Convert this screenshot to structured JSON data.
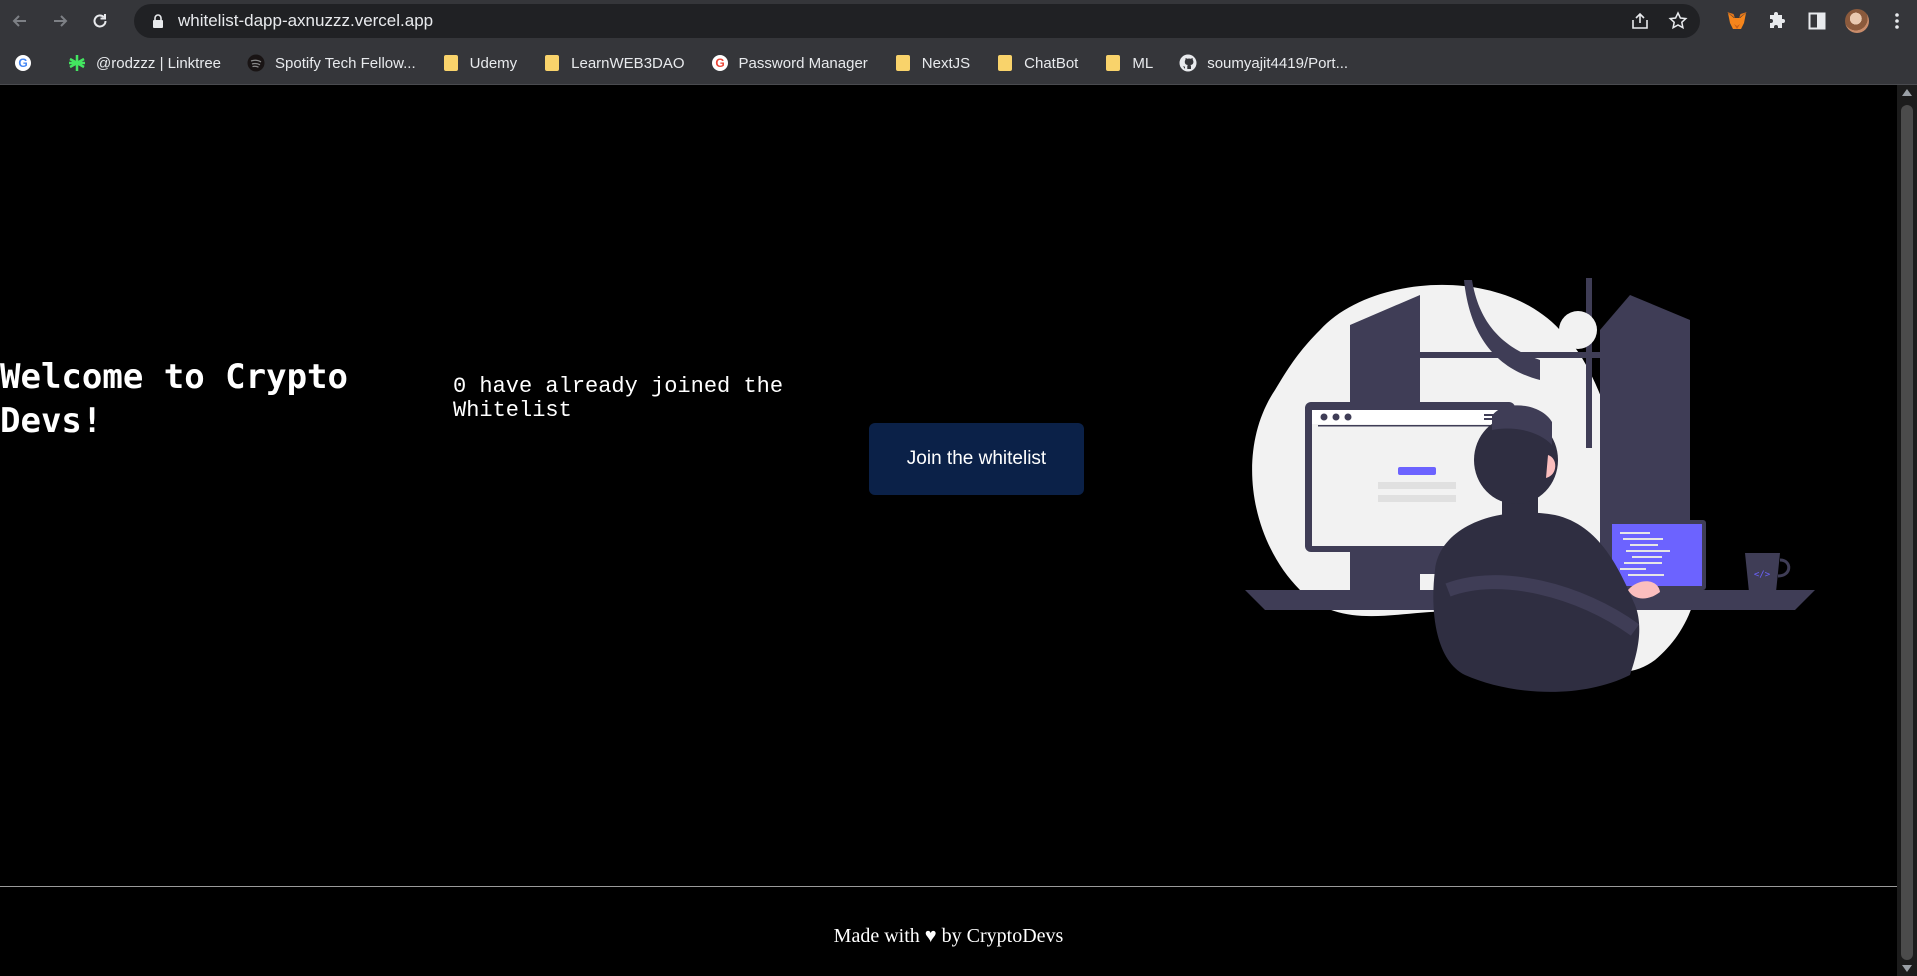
{
  "browser": {
    "url": "whitelist-dapp-axnuzzz.vercel.app",
    "bookmarks": [
      {
        "label": "",
        "icon": "google-icon"
      },
      {
        "label": "@rodzzz | Linktree",
        "icon": "linktree-icon"
      },
      {
        "label": "Spotify Tech Fellow...",
        "icon": "spotify-icon"
      },
      {
        "label": "Udemy",
        "icon": "folder-icon"
      },
      {
        "label": "LearnWEB3DAO",
        "icon": "folder-icon"
      },
      {
        "label": "Password Manager",
        "icon": "google-icon"
      },
      {
        "label": "NextJS",
        "icon": "folder-icon"
      },
      {
        "label": "ChatBot",
        "icon": "folder-icon"
      },
      {
        "label": "ML",
        "icon": "folder-icon"
      },
      {
        "label": "soumyajit4419/Port...",
        "icon": "github-icon"
      }
    ]
  },
  "main": {
    "title": "Welcome to Crypto Devs!",
    "description": "0 have already joined the Whitelist",
    "join_button": "Join the whitelist"
  },
  "footer": {
    "text": "Made with ♥ by CryptoDevs"
  },
  "colors": {
    "page_bg": "#000000",
    "button_bg": "#0b2148",
    "accent_purple": "#6c63ff",
    "figure_dark": "#3f3d56",
    "blob_light": "#f2f2f2"
  }
}
